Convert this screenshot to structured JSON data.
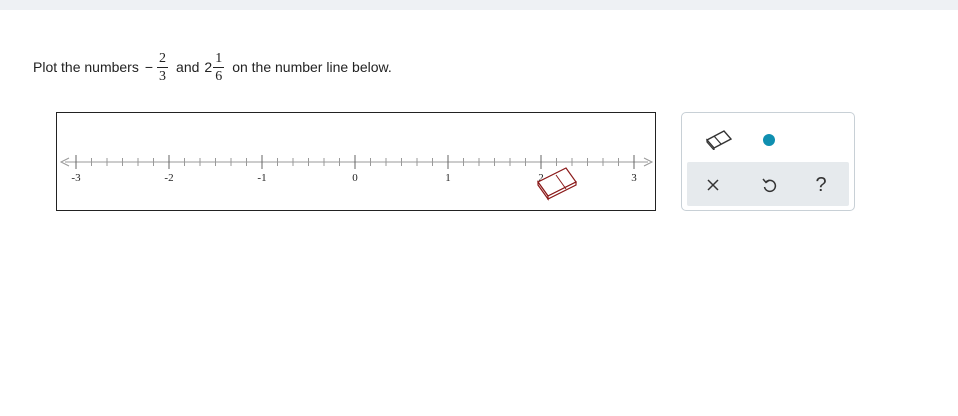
{
  "question": {
    "prefix": "Plot the numbers",
    "neg_sign": "−",
    "frac1": {
      "num": "2",
      "den": "3"
    },
    "connector": "and",
    "mixed_whole": "2",
    "frac2": {
      "num": "1",
      "den": "6"
    },
    "suffix": "on the number line below."
  },
  "number_line": {
    "min": -3,
    "max": 3,
    "subdivisions": 6,
    "labels": [
      "-3",
      "-2",
      "-1",
      "0",
      "1",
      "2",
      "3"
    ]
  },
  "toolbar": {
    "tools": [
      "eraser-tool",
      "point-tool"
    ],
    "actions": [
      "clear",
      "undo",
      "help"
    ],
    "help_label": "?",
    "clear_label": "×",
    "accent": "#0f8fb0"
  }
}
